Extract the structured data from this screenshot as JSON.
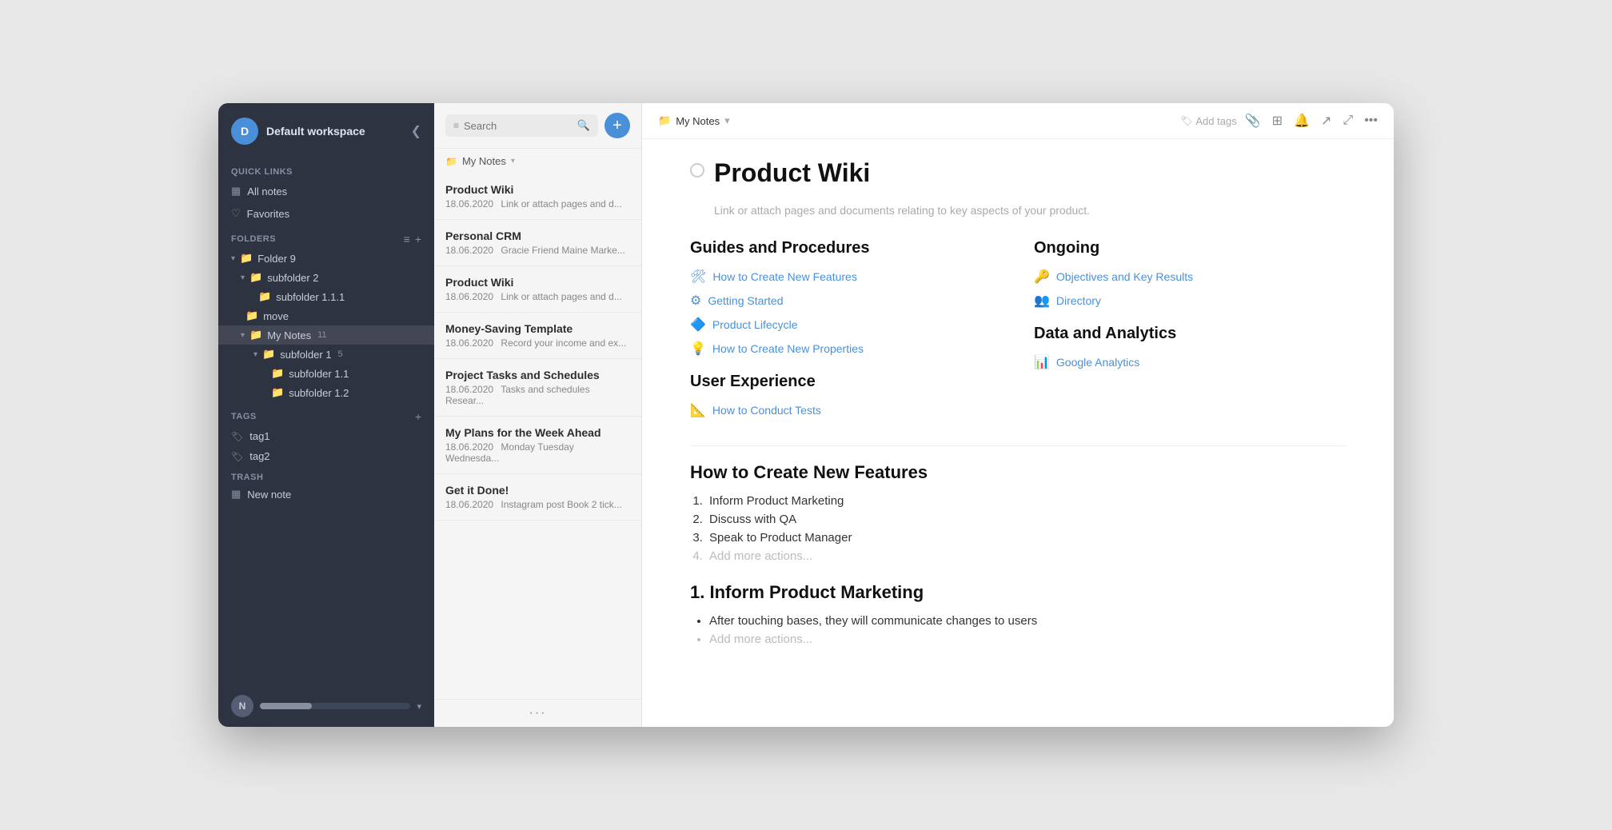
{
  "workspace": {
    "avatar_letter": "D",
    "name": "Default workspace",
    "collapse_icon": "❮"
  },
  "quick_links": {
    "label": "Quick Links",
    "items": [
      {
        "id": "all-notes",
        "icon": "▦",
        "label": "All notes"
      },
      {
        "id": "favorites",
        "icon": "♡",
        "label": "Favorites"
      }
    ]
  },
  "folders": {
    "label": "Folders",
    "sort_icon": "≡",
    "add_icon": "+",
    "tree": [
      {
        "id": "folder9",
        "indent": 0,
        "chevron": "▾",
        "icon": "📁",
        "label": "Folder 9",
        "badge": ""
      },
      {
        "id": "subfolder2",
        "indent": 1,
        "chevron": "▾",
        "icon": "📁",
        "label": "subfolder 2",
        "badge": ""
      },
      {
        "id": "subfolder1-1-1",
        "indent": 2,
        "chevron": "",
        "icon": "📁",
        "label": "subfolder 1.1.1",
        "badge": ""
      },
      {
        "id": "move",
        "indent": 1,
        "chevron": "",
        "icon": "📁",
        "label": "move",
        "badge": ""
      },
      {
        "id": "mynotes",
        "indent": 1,
        "chevron": "▾",
        "icon": "📁",
        "label": "My Notes",
        "badge": "11",
        "active": true
      },
      {
        "id": "subfolder1",
        "indent": 2,
        "chevron": "▾",
        "icon": "📁",
        "label": "subfolder 1",
        "badge": "5"
      },
      {
        "id": "subfolder1-1",
        "indent": 3,
        "chevron": "",
        "icon": "📁",
        "label": "subfolder 1.1",
        "badge": ""
      },
      {
        "id": "subfolder1-2",
        "indent": 3,
        "chevron": "",
        "icon": "📁",
        "label": "subfolder 1.2",
        "badge": ""
      }
    ]
  },
  "tags": {
    "label": "Tags",
    "add_icon": "+",
    "items": [
      {
        "id": "tag1",
        "label": "tag1"
      },
      {
        "id": "tag2",
        "label": "tag2"
      }
    ]
  },
  "trash": {
    "label": "Trash"
  },
  "new_note": {
    "icon": "▦",
    "label": "New note"
  },
  "footer": {
    "avatar": "N",
    "arrow": "▾"
  },
  "search": {
    "placeholder": "Search",
    "filter_icon": "≡",
    "search_icon": "🔍"
  },
  "add_button": "+",
  "folder_breadcrumb": {
    "icon": "📁",
    "name": "My Notes",
    "chevron": "▾"
  },
  "notes": [
    {
      "id": "product-wiki-1",
      "title": "Product Wiki",
      "date": "18.06.2020",
      "preview": "Link or attach pages and d..."
    },
    {
      "id": "personal-crm",
      "title": "Personal CRM",
      "date": "18.06.2020",
      "preview": "Gracie Friend Maine Marke..."
    },
    {
      "id": "product-wiki-2",
      "title": "Product Wiki",
      "date": "18.06.2020",
      "preview": "Link or attach pages and d..."
    },
    {
      "id": "money-saving",
      "title": "Money-Saving Template",
      "date": "18.06.2020",
      "preview": "Record your income and ex..."
    },
    {
      "id": "project-tasks",
      "title": "Project Tasks and Schedules",
      "date": "18.06.2020",
      "preview": "Tasks and schedules Resear..."
    },
    {
      "id": "my-plans",
      "title": "My Plans for the Week Ahead",
      "date": "18.06.2020",
      "preview": "Monday Tuesday Wednesda..."
    },
    {
      "id": "get-done",
      "title": "Get it Done!",
      "date": "18.06.2020",
      "preview": "Instagram post Book 2 tick..."
    }
  ],
  "header": {
    "breadcrumb_icon": "📁",
    "breadcrumb_name": "My Notes",
    "breadcrumb_chevron": "▾",
    "tag_icon": "🏷",
    "tag_label": "Add tags",
    "toolbar_icons": [
      "📎",
      "⊞",
      "🔔",
      "↗",
      "⤢",
      "•••"
    ]
  },
  "note": {
    "title": "Product Wiki",
    "subtitle": "Link or attach pages and documents relating to key aspects of your product.",
    "sections": {
      "guides_heading": "Guides and Procedures",
      "ongoing_heading": "Ongoing",
      "data_analytics_heading": "Data and Analytics",
      "user_experience_heading": "User Experience",
      "guides_links": [
        {
          "emoji": "🛠",
          "label": "How to Create New Features"
        },
        {
          "emoji": "⚙",
          "label": "Getting Started"
        },
        {
          "emoji": "🔷",
          "label": "Product Lifecycle"
        },
        {
          "emoji": "💡",
          "label": "How to Create New Properties"
        }
      ],
      "ongoing_links": [
        {
          "emoji": "🔑",
          "label": "Objectives and Key Results"
        },
        {
          "emoji": "👥",
          "label": "Directory"
        }
      ],
      "data_links": [
        {
          "emoji": "📊",
          "label": "Google Analytics"
        }
      ],
      "ux_links": [
        {
          "emoji": "📐",
          "label": "How to Conduct Tests"
        }
      ],
      "features_heading": "How to Create New Features",
      "features_list": [
        {
          "label": "Inform Product Marketing",
          "faded": false
        },
        {
          "label": "Discuss with QA",
          "faded": false
        },
        {
          "label": "Speak to Product Manager",
          "faded": false
        },
        {
          "label": "Add more actions...",
          "faded": true
        }
      ],
      "inform_heading": "1. Inform Product Marketing",
      "inform_bullets": [
        {
          "label": "After touching bases, they will communicate changes to users",
          "faded": false
        },
        {
          "label": "Add more actions...",
          "faded": true
        }
      ]
    }
  }
}
